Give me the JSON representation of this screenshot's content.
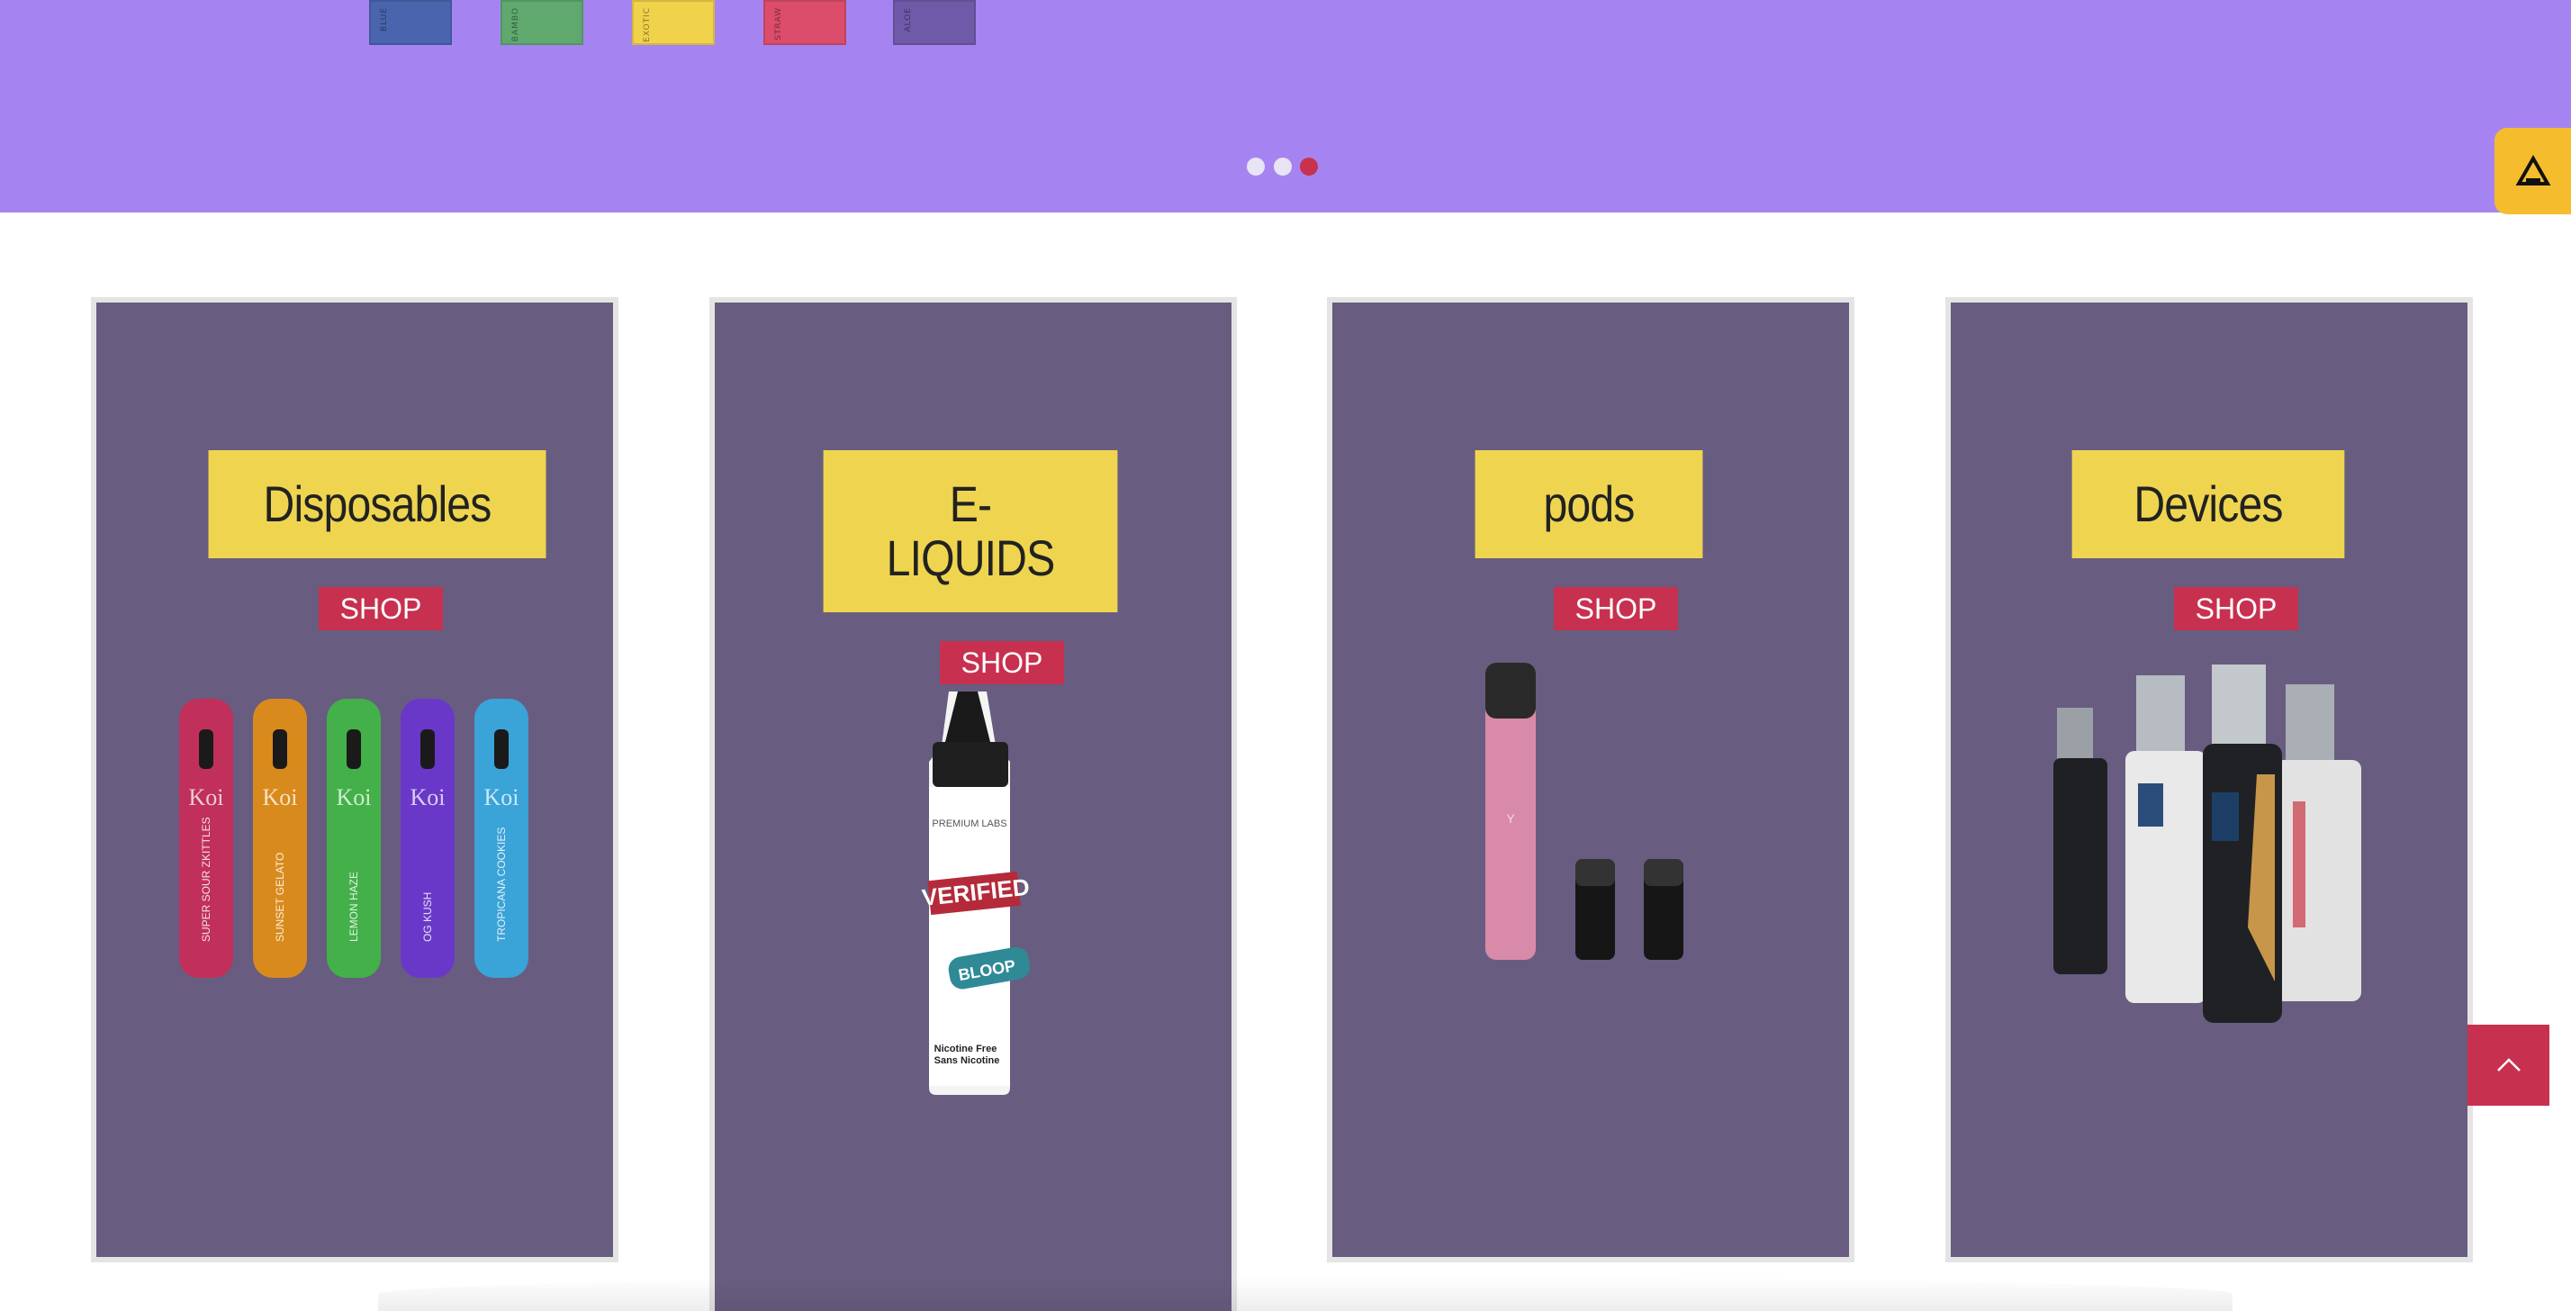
{
  "hero": {
    "background": "#a584f1",
    "swatches": [
      {
        "label": "BLUE",
        "color": "#4a64ae"
      },
      {
        "label": "BAMBO",
        "color": "#5fa96f"
      },
      {
        "label": "EXOTIC",
        "color": "#f0d24b"
      },
      {
        "label": "STRAW",
        "color": "#db4d6a"
      },
      {
        "label": "ALOE",
        "color": "#6e5aa8"
      }
    ],
    "slider_dots": [
      {
        "active": false
      },
      {
        "active": false
      },
      {
        "active": true
      }
    ],
    "dot_color": "#e8e4f4",
    "dot_active_color": "#c8324f"
  },
  "badge": {
    "icon": "brand-logo-icon",
    "color": "#f5bd2e"
  },
  "colors": {
    "card_bg": "#685d80",
    "title_bg": "#efd54f",
    "shop_bg": "#c8304f",
    "to_top_bg": "#c8304f"
  },
  "categories": [
    {
      "title": "Disposables",
      "shop_label": "SHOP",
      "image": "disposable-vape-pens",
      "pens": [
        {
          "color": "#c0305a",
          "text": "SUPER SOUR ZKITTLES"
        },
        {
          "color": "#d98a1c",
          "text": "SUNSET GELATO"
        },
        {
          "color": "#43b04a",
          "text": "LEMON HAZE"
        },
        {
          "color": "#6a38c8",
          "text": "OG KUSH"
        },
        {
          "color": "#3aa3d8",
          "text": "TROPICANA COOKIES"
        }
      ],
      "pen_brand": "Koi"
    },
    {
      "title": "E-\nLIQUIDS",
      "shop_label": "SHOP",
      "image": "e-liquid-bottle",
      "bottle": {
        "brand": "PREMIUM LABS",
        "name": "VERIFIED",
        "flavor": "BLOOP",
        "note": "Nicotine Free\nSans Nicotine"
      }
    },
    {
      "title": "pods",
      "shop_label": "SHOP",
      "image": "pod-system",
      "pod_color": "#d98aa8"
    },
    {
      "title": "Devices",
      "shop_label": "SHOP",
      "image": "vape-mod-devices"
    }
  ],
  "to_top": {
    "icon": "chevron-up-icon"
  }
}
